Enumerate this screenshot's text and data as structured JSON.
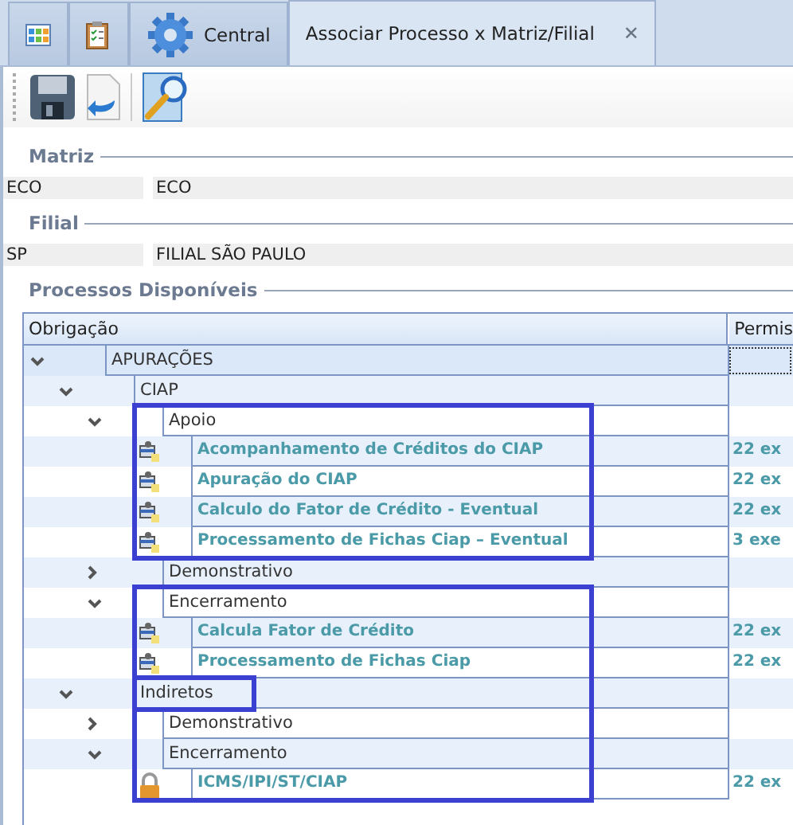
{
  "tabs": [
    {
      "kind": "grid",
      "selected": false
    },
    {
      "kind": "clipboard",
      "selected": false
    },
    {
      "kind": "gear",
      "label": "Central",
      "selected": false
    },
    {
      "kind": "text",
      "label": "Associar Processo x Matriz/Filial",
      "selected": true,
      "close": "✕"
    }
  ],
  "toolbar": [
    {
      "kind": "save"
    },
    {
      "kind": "undo"
    },
    {
      "kind": "search"
    }
  ],
  "matriz": {
    "title": "Matriz",
    "code": "ECO",
    "name": "ECO"
  },
  "filial": {
    "title": "Filial",
    "code": "SP",
    "name": "FILIAL SÃO PAULO"
  },
  "processos": {
    "title": "Processos Disponíveis",
    "columns": [
      "Obrigação",
      "Permis"
    ],
    "tree": [
      {
        "label": "APURAÇÕES",
        "expanded": true,
        "selected": true,
        "children": [
          {
            "label": "CIAP",
            "expanded": true,
            "selected": false,
            "children": [
              {
                "label": "Apoio",
                "expanded": true,
                "selected": false,
                "frame_start": true,
                "children": [
                  {
                    "label": "Acompanhamento de Créditos do CIAP",
                    "kind": "document",
                    "permission": "22 ex",
                    "selected": false
                  },
                  {
                    "label": "Apuração do CIAP",
                    "kind": "document",
                    "permission": "22 ex",
                    "selected": false
                  },
                  {
                    "label": "Calculo do Fator de Crédito - Eventual",
                    "kind": "document",
                    "permission": "22 ex",
                    "selected": false
                  },
                  {
                    "label": "Processamento de Fichas Ciap – Eventual",
                    "kind": "document",
                    "permission": "3 exe",
                    "selected": false,
                    "frame_end": true
                  }
                ]
              },
              {
                "label": "Demonstrativo",
                "expanded": false,
                "selected": false
              },
              {
                "label": "Encerramento",
                "expanded": true,
                "selected": false,
                "frame_start": true,
                "children": [
                  {
                    "label": "Calcula Fator de Crédito",
                    "kind": "document",
                    "permission": "22 ex",
                    "selected": false
                  },
                  {
                    "label": "Processamento de Fichas Ciap",
                    "kind": "document",
                    "permission": "22 ex",
                    "selected": false
                  }
                ]
              }
            ]
          },
          {
            "label": "Indiretos",
            "expanded": true,
            "selected": false,
            "framed": true,
            "children": [
              {
                "label": "Demonstrativo",
                "expanded": false,
                "selected": false
              },
              {
                "label": "Encerramento",
                "expanded": true,
                "selected": false,
                "children": [
                  {
                    "label": "ICMS/IPI/ST/CIAP",
                    "kind": "locked",
                    "permission": "22 ex",
                    "selected": false,
                    "frame_end": true
                  }
                ]
              }
            ]
          }
        ]
      }
    ]
  }
}
